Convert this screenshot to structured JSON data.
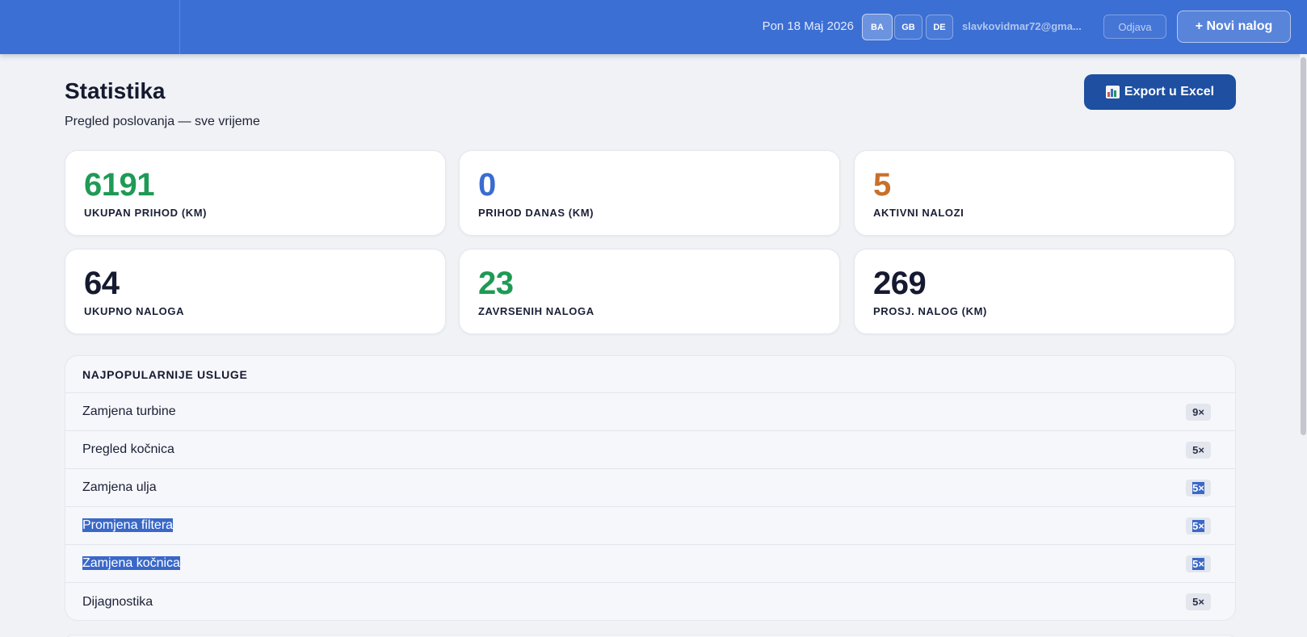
{
  "header": {
    "date": "Pon 18 Maj 2026",
    "languages": [
      "BA",
      "GB",
      "DE"
    ],
    "active_language": "BA",
    "email": "slavkovidmar72@gma...",
    "logout_label": "Odjava",
    "new_order_label": "+ Novi nalog"
  },
  "page": {
    "title": "Statistika",
    "subtitle": "Pregled poslovanja — sve vrijeme",
    "export_label": "Export u Excel",
    "export_icon": "bar-chart-icon"
  },
  "stats": [
    {
      "value": "6191",
      "label": "UKUPAN PRIHOD (KM)",
      "color": "#1f9a55"
    },
    {
      "value": "0",
      "label": "PRIHOD DANAS (KM)",
      "color": "#3a6bd1"
    },
    {
      "value": "5",
      "label": "AKTIVNI NALOZI",
      "color": "#c8702a"
    },
    {
      "value": "64",
      "label": "UKUPNO NALOGA",
      "color": "#151a30"
    },
    {
      "value": "23",
      "label": "ZAVRSENIH NALOGA",
      "color": "#1f9a55"
    },
    {
      "value": "269",
      "label": "PROSJ. NALOG (KM)",
      "color": "#151a30"
    }
  ],
  "services": {
    "title": "NAJPOPULARNIJE USLUGE",
    "rows": [
      {
        "name": "Zamjena turbine",
        "count": "9×"
      },
      {
        "name": "Pregled kočnica",
        "count": "5×"
      },
      {
        "name": "Zamjena ulja",
        "count": "5×"
      },
      {
        "name": "Promjena filtera",
        "count": "5×"
      },
      {
        "name": "Zamjena kočnica",
        "count": "5×"
      },
      {
        "name": "Dijagnostika",
        "count": "5×"
      }
    ]
  },
  "colors": {
    "header_bg": "#3b6fd4",
    "export_bg": "#1e4fa0",
    "selection": "#3a68c9"
  }
}
